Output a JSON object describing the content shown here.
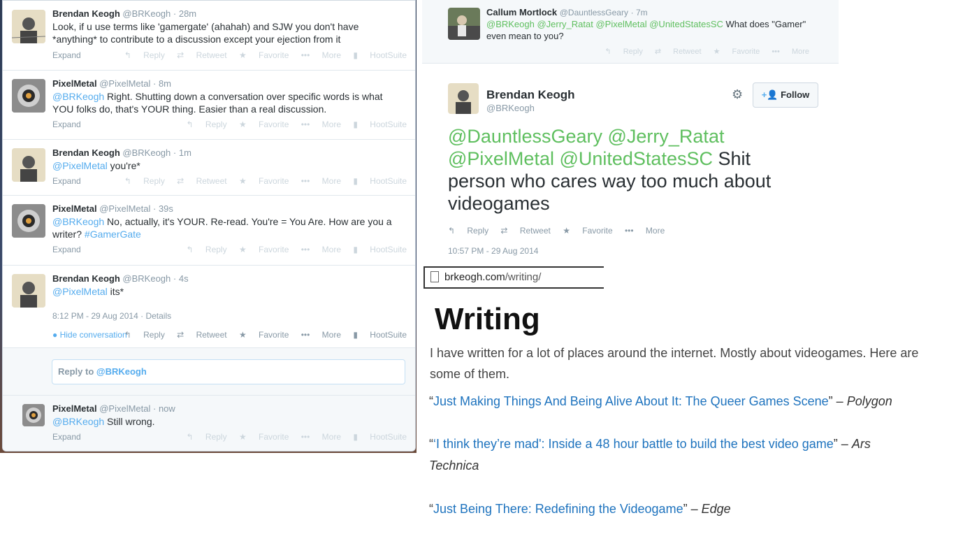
{
  "left": {
    "tweets": [
      {
        "name": "Brendan Keogh",
        "handle": "@BRKeogh",
        "time": "· 28m",
        "text": "Look, if u use terms like 'gamergate' (ahahah) and SJW you don't have *anything* to contribute to a discussion except your ejection from it",
        "expand": "Expand"
      },
      {
        "name": "PixelMetal",
        "handle": "@PixelMetal",
        "time": "· 8m",
        "mention": "@BRKeogh",
        "text": " Right. Shutting down a conversation over specific words is what YOU folks do, that's YOUR thing. Easier than a real discussion.",
        "expand": "Expand"
      },
      {
        "name": "Brendan Keogh",
        "handle": "@BRKeogh",
        "time": "· 1m",
        "mention": "@PixelMetal",
        "text": " you're*",
        "expand": "Expand"
      },
      {
        "name": "PixelMetal",
        "handle": "@PixelMetal",
        "time": "· 39s",
        "mention": "@BRKeogh",
        "text": " No, actually, it's YOUR. Re-read. You're = You Are. How are you a writer? ",
        "hashtag": "#GamerGate",
        "expand": "Expand"
      },
      {
        "name": "Brendan Keogh",
        "handle": "@BRKeogh",
        "time": "· 4s",
        "mention": "@PixelMetal",
        "text": " its*",
        "datetime": "8:12 PM - 29 Aug 2014",
        "details": "· Details",
        "hide": "Hide conversation"
      },
      {
        "name": "PixelMetal",
        "handle": "@PixelMetal",
        "time": "· now",
        "mention": "@BRKeogh",
        "text": " Still wrong.",
        "expand": "Expand"
      }
    ],
    "actions": {
      "reply": "Reply",
      "retweet": "Retweet",
      "favorite": "Favorite",
      "more": "More",
      "hootsuite": "HootSuite"
    },
    "reply_box": {
      "label": "Reply to ",
      "mention": "@BRKeogh"
    }
  },
  "callum": {
    "name": "Callum Mortlock",
    "handle": "@DauntlessGeary",
    "time": "· 7m",
    "mentions": "@BRKeogh @Jerry_Ratat @PixelMetal @UnitedStatesSC",
    "text": " What does \"Gamer\" even mean to you?"
  },
  "main_tweet": {
    "name": "Brendan Keogh",
    "handle": "@BRKeogh",
    "follow": "Follow",
    "mentions_line1": "@DauntlessGeary @Jerry_Ratat",
    "mentions_line2": "@PixelMetal @UnitedStatesSC",
    "text_line2": " Shit",
    "text_line3": "person who cares way too much about",
    "text_line4": "videogames",
    "datetime": "10:57 PM - 29 Aug 2014"
  },
  "browser": {
    "url_domain": "brkeogh.com",
    "url_path": "/writing/"
  },
  "writing": {
    "heading": "Writing",
    "intro": "I have written for a lot of places around the internet. Mostly about videogames. Here are some of them.",
    "items": [
      {
        "open": "“",
        "title": "Just Making Things And Being Alive About It: The Queer Games Scene",
        "close": "” – ",
        "source": "Polygon"
      },
      {
        "open": "“",
        "title": "‘I think they’re mad': Inside a 48 hour battle to build the best video game",
        "close": "” – ",
        "source": "Ars Technica"
      },
      {
        "open": "“",
        "title": "Just Being There: Redefining the Videogame",
        "close": "” – ",
        "source": "Edge"
      }
    ]
  },
  "colors": {
    "link_blue": "#55acee",
    "article_link": "#1e73be",
    "follow_blue": "#55acee"
  }
}
